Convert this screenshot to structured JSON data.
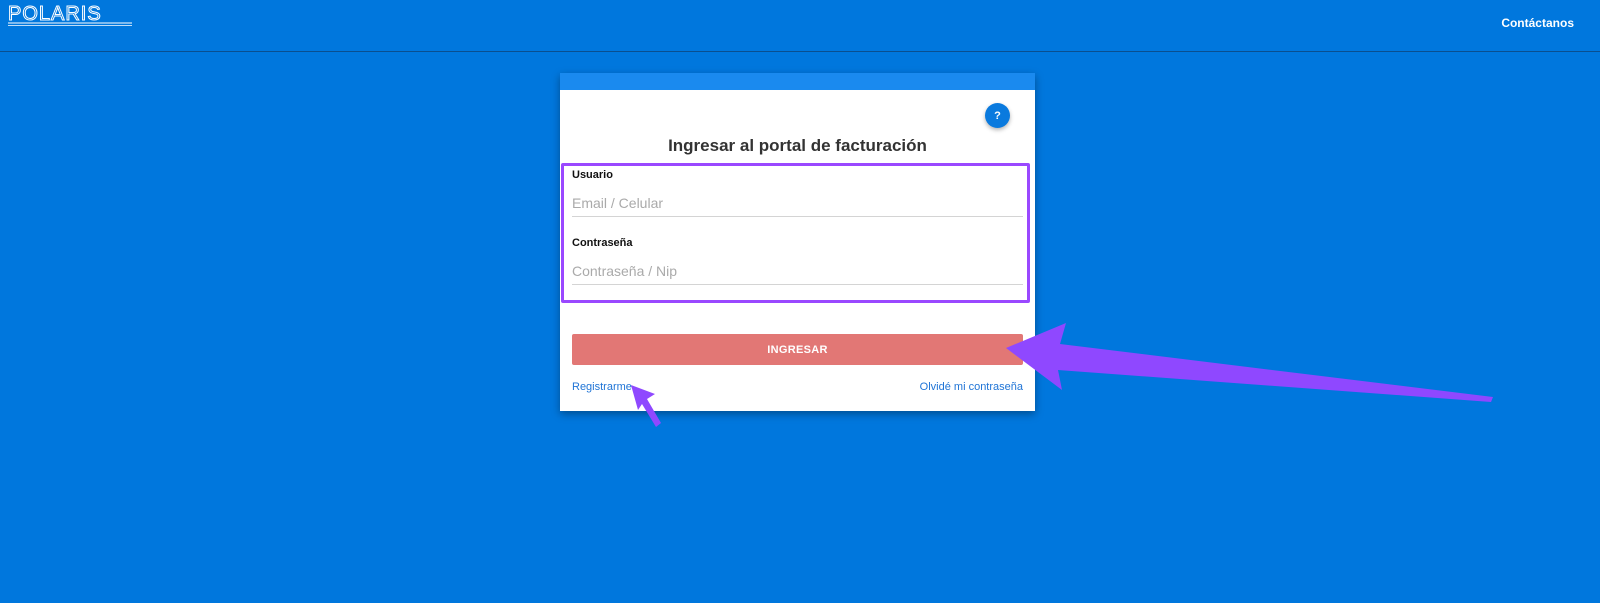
{
  "header": {
    "logo_text": "POLARIS",
    "contact_label": "Contáctanos"
  },
  "login": {
    "help_label": "?",
    "title": "Ingresar al portal de facturación",
    "user": {
      "label": "Usuario",
      "placeholder": "Email / Celular",
      "value": ""
    },
    "password": {
      "label": "Contraseña",
      "placeholder": "Contraseña / Nip",
      "value": ""
    },
    "submit_label": "INGRESAR",
    "register_label": "Registrarme",
    "forgot_label": "Olvidé mi contraseña"
  },
  "colors": {
    "background": "#0077dd",
    "card_header": "#1a8aef",
    "submit": "#e27775",
    "annotation": "#9a48ff",
    "link": "#1f74d6"
  },
  "annotations": {
    "highlight": "form-fields-box",
    "arrows": [
      "arrow-to-submit-button",
      "arrow-to-register-link"
    ]
  }
}
